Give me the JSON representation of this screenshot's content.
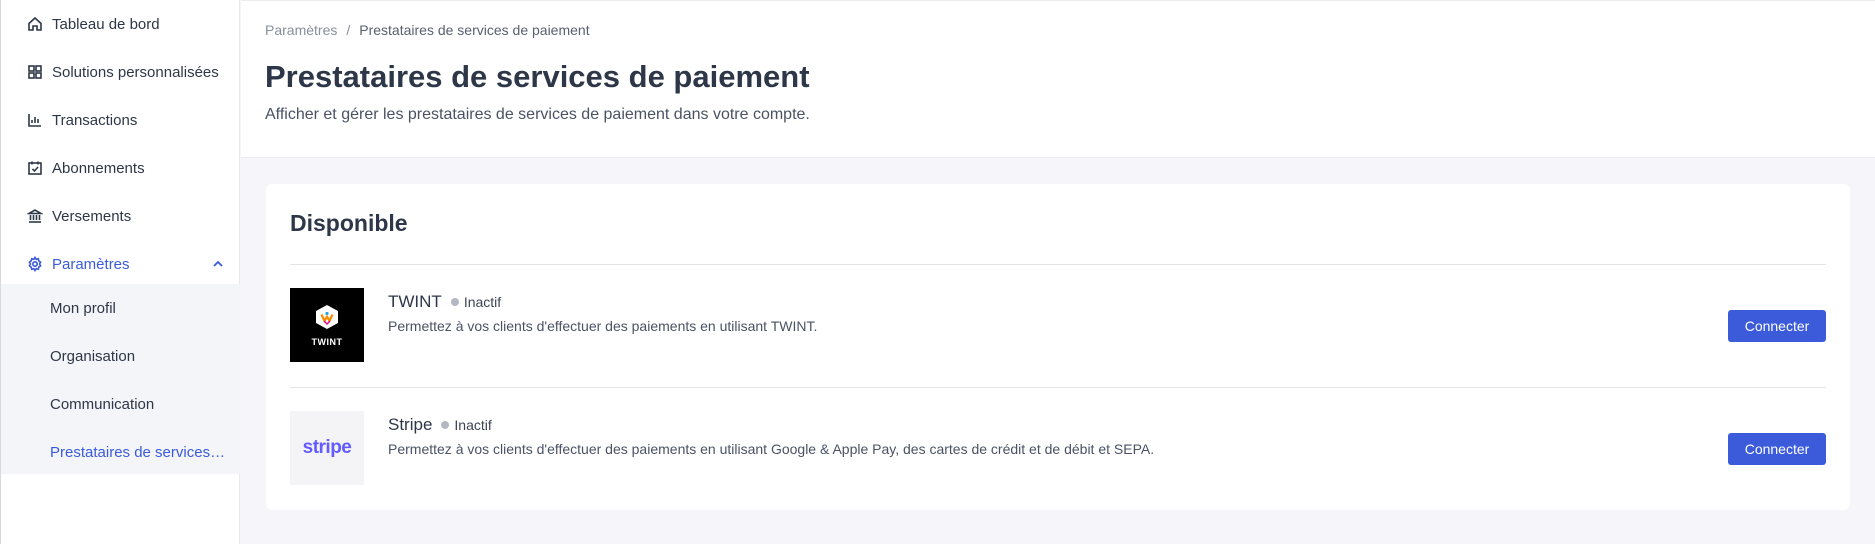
{
  "sidebar": {
    "items": [
      {
        "label": "Tableau de bord",
        "icon": "home-icon"
      },
      {
        "label": "Solutions personnalisées",
        "icon": "grid-icon"
      },
      {
        "label": "Transactions",
        "icon": "bar-chart-icon"
      },
      {
        "label": "Abonnements",
        "icon": "calendar-check-icon"
      },
      {
        "label": "Versements",
        "icon": "bank-icon"
      },
      {
        "label": "Paramètres",
        "icon": "gear-icon",
        "active": true,
        "expanded": true
      }
    ],
    "subitems": [
      {
        "label": "Mon profil"
      },
      {
        "label": "Organisation"
      },
      {
        "label": "Communication"
      },
      {
        "label": "Prestataires de services de paiement",
        "active": true
      }
    ]
  },
  "header": {
    "breadcrumb": {
      "parent": "Paramètres",
      "separator": "/",
      "current": "Prestataires de services de paiement"
    },
    "title": "Prestataires de services de paiement",
    "subtitle": "Afficher et gérer les prestataires de services de paiement dans votre compte."
  },
  "available": {
    "title": "Disponible",
    "providers": [
      {
        "name": "TWINT",
        "logo_text": "TWINT",
        "status": "Inactif",
        "description": "Permettez à vos clients d'effectuer des paiements en utilisant TWINT.",
        "button": "Connecter"
      },
      {
        "name": "Stripe",
        "logo_text": "stripe",
        "status": "Inactif",
        "description": "Permettez à vos clients d'effectuer des paiements en utilisant Google & Apple Pay, des cartes de crédit et de débit et SEPA.",
        "button": "Connecter"
      }
    ]
  },
  "colors": {
    "accent": "#3b5bdb",
    "text": "#2d3748",
    "status_inactive": "#b4b8c2",
    "stripe_brand": "#635bff"
  }
}
